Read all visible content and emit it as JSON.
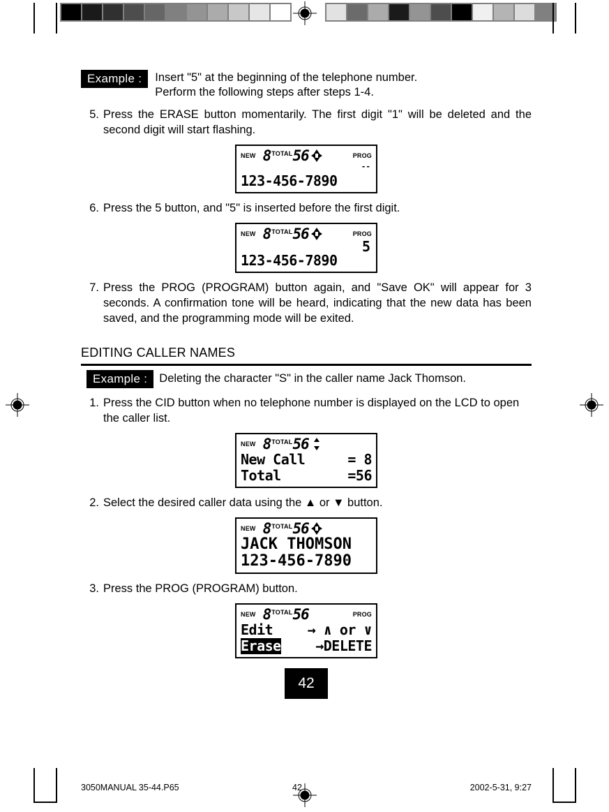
{
  "calibration": {
    "left_strip": [
      "#000000",
      "#1a1a1a",
      "#303030",
      "#4d4d4d",
      "#666666",
      "#808080",
      "#949494",
      "#ababab",
      "#c8c8c8",
      "#e6e6e6",
      "#ffffff"
    ],
    "right_strip": [
      "#e2e2e2",
      "#6b6b6b",
      "#ababab",
      "#1a1a1a",
      "#949494",
      "#4d4d4d",
      "#000000",
      "#f0f0f0",
      "#b4b4b4",
      "#dcdcdc",
      "#808080"
    ]
  },
  "example_1": {
    "tag": "Example :",
    "line1": "Insert \"5\" at the beginning of the telephone number.",
    "line2": "Perform the following steps after steps 1-4."
  },
  "steps_top": [
    {
      "num": "5.",
      "text": "Press the ERASE button momentarily. The first digit \"1\" will be deleted and the second digit will start flashing."
    },
    {
      "num": "6.",
      "text": "Press the 5 button, and \"5\" is inserted before the first digit."
    },
    {
      "num": "7.",
      "text": "Press the PROG (PROGRAM) button again, and \"Save OK\" will appear for 3 seconds. A confirmation tone will be heard, indicating that the new data has been saved, and the programming mode will be exited."
    }
  ],
  "lcd_1": {
    "new_label": "NEW",
    "new_count": "8",
    "total_label": "TOTAL",
    "total_count": "56",
    "prog_label": "PROG",
    "caret": "--",
    "line": "123-456-7890"
  },
  "lcd_2": {
    "new_label": "NEW",
    "new_count": "8",
    "total_label": "TOTAL",
    "total_count": "56",
    "prog_label": "PROG",
    "caret": "5",
    "line": "123-456-7890"
  },
  "section": {
    "heading": "EDITING CALLER NAMES"
  },
  "example_2": {
    "tag": "Example :",
    "text": "Deleting the character \"S\" in the caller name Jack Thomson."
  },
  "steps_bottom": [
    {
      "num": "1.",
      "text": "Press the CID button when no telephone number is displayed on the LCD to open the caller list."
    },
    {
      "num": "2.",
      "text": "Select the desired caller data using the ▲ or ▼ button."
    },
    {
      "num": "3.",
      "text": "Press the PROG (PROGRAM) button."
    }
  ],
  "lcd_3": {
    "new_label": "NEW",
    "new_count": "8",
    "total_label": "TOTAL",
    "total_count": "56",
    "row1_left": "New Call",
    "row1_right": "= 8",
    "row2_left": "Total",
    "row2_right": "=56"
  },
  "lcd_4": {
    "new_label": "NEW",
    "new_count": "8",
    "total_label": "TOTAL",
    "total_count": "56",
    "row1": "JACK THOMSON",
    "row2": "123-456-7890"
  },
  "lcd_5": {
    "new_label": "NEW",
    "new_count": "8",
    "total_label": "TOTAL",
    "total_count": "56",
    "prog_label": "PROG",
    "row1_left": "Edit",
    "row1_right": "→ ∧ or ∨",
    "row2_left": "Erase",
    "row2_right": "→DELETE"
  },
  "page_number": "42",
  "footer": {
    "file": "3050MANUAL 35-44.P65",
    "page": "42",
    "date": "2002-5-31, 9:27"
  }
}
